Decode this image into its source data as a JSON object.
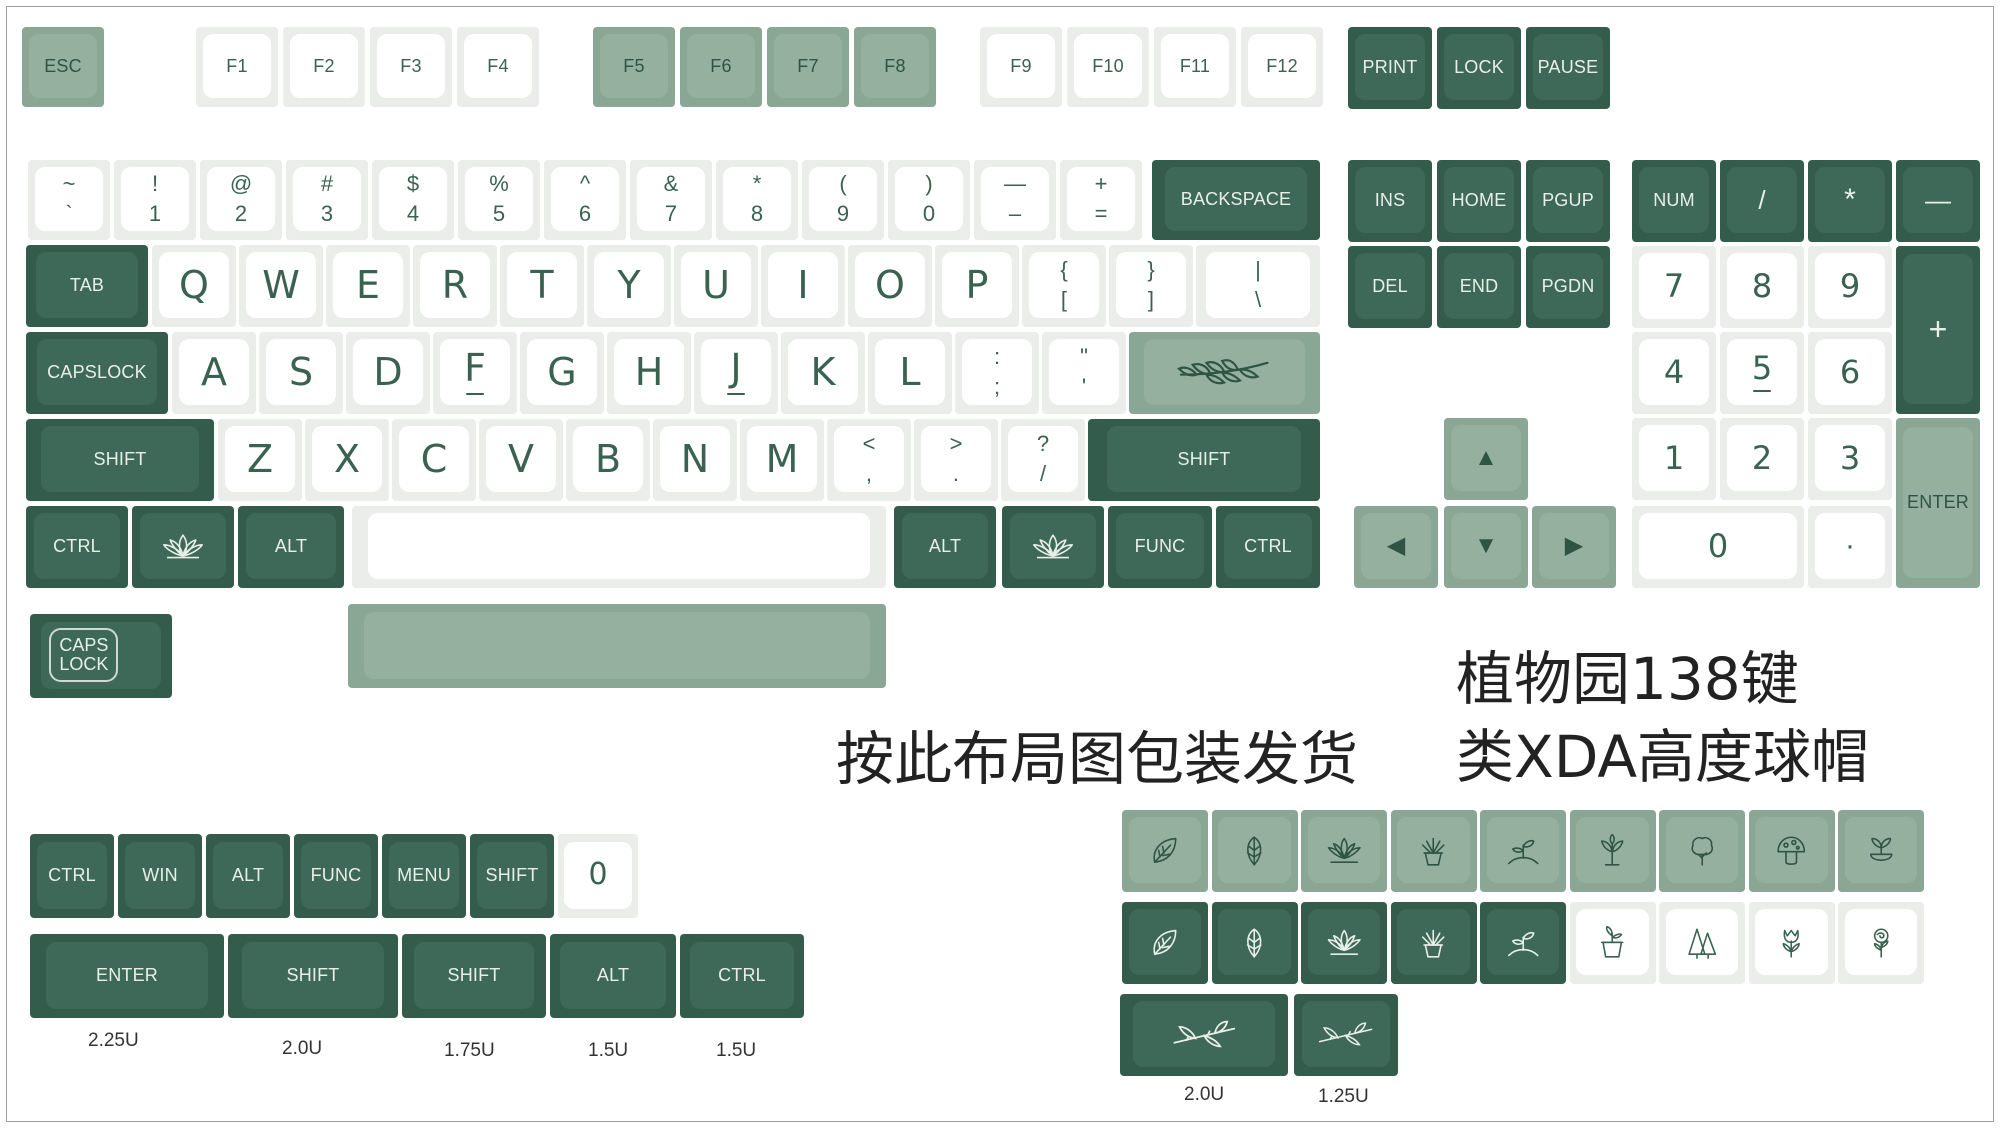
{
  "colors": {
    "light_key": "#ffffff",
    "light_key_edge": "#ebedeb",
    "dark_key": "#345c4d",
    "sage_key": "#8aa694",
    "legend_dark": "#3a6250",
    "legend_light": "#e8efe9"
  },
  "function_row": {
    "esc": "ESC",
    "f1": "F1",
    "f2": "F2",
    "f3": "F3",
    "f4": "F4",
    "f5": "F5",
    "f6": "F6",
    "f7": "F7",
    "f8": "F8",
    "f9": "F9",
    "f10": "F10",
    "f11": "F11",
    "f12": "F12",
    "print": "PRINT",
    "lock": "LOCK",
    "pause": "PAUSE"
  },
  "number_row": {
    "k1": {
      "top": "~",
      "bottom": "`"
    },
    "k2": {
      "top": "!",
      "bottom": "1"
    },
    "k3": {
      "top": "@",
      "bottom": "2"
    },
    "k4": {
      "top": "#",
      "bottom": "3"
    },
    "k5": {
      "top": "$",
      "bottom": "4"
    },
    "k6": {
      "top": "%",
      "bottom": "5"
    },
    "k7": {
      "top": "^",
      "bottom": "6"
    },
    "k8": {
      "top": "&",
      "bottom": "7"
    },
    "k9": {
      "top": "*",
      "bottom": "8"
    },
    "k10": {
      "top": "(",
      "bottom": "9"
    },
    "k11": {
      "top": ")",
      "bottom": "0"
    },
    "k12": {
      "top": "—",
      "bottom": "–"
    },
    "k13": {
      "top": "+",
      "bottom": "="
    },
    "backspace": "BACKSPACE"
  },
  "qwerty_row": {
    "tab": "TAB",
    "letters": [
      "Q",
      "W",
      "E",
      "R",
      "T",
      "Y",
      "U",
      "I",
      "O",
      "P"
    ],
    "lbrace": {
      "top": "{",
      "bottom": "["
    },
    "rbrace": {
      "top": "}",
      "bottom": "]"
    },
    "pipe": {
      "top": "|",
      "bottom": "\\"
    }
  },
  "home_row": {
    "capslock": "CAPSLOCK",
    "letters": [
      "A",
      "S",
      "D",
      "F",
      "G",
      "H",
      "J",
      "K",
      "L"
    ],
    "semicolon": {
      "top": ":",
      "bottom": ";"
    },
    "quote": {
      "top": "\"",
      "bottom": "'"
    },
    "enter_icon": "leaf-branch-icon"
  },
  "shift_row": {
    "lshift": "SHIFT",
    "letters": [
      "Z",
      "X",
      "C",
      "V",
      "B",
      "N",
      "M"
    ],
    "comma": {
      "top": "<",
      "bottom": ","
    },
    "period": {
      "top": ">",
      "bottom": "."
    },
    "slash": {
      "top": "?",
      "bottom": "/"
    },
    "rshift": "SHIFT"
  },
  "bottom_row": {
    "lctrl": "CTRL",
    "lwin_icon": "lotus-icon",
    "lalt": "ALT",
    "ralt": "ALT",
    "rwin_icon": "lotus-icon",
    "func": "FUNC",
    "rctrl": "CTRL"
  },
  "nav_cluster": {
    "ins": "INS",
    "home": "HOME",
    "pgup": "PGUP",
    "del": "DEL",
    "end": "END",
    "pgdn": "PGDN",
    "up": "▲",
    "left": "◀",
    "down": "▼",
    "right": "▶"
  },
  "numpad": {
    "num": "NUM",
    "divide": "/",
    "multiply": "*",
    "minus": "—",
    "n7": "7",
    "n8": "8",
    "n9": "9",
    "plus": "+",
    "n4": "4",
    "n5": "5",
    "n6": "6",
    "n1": "1",
    "n2": "2",
    "n3": "3",
    "enter": "ENTER",
    "n0": "0",
    "dot": "·"
  },
  "extras": {
    "caps_lock_line1": "CAPS",
    "caps_lock_line2": "LOCK"
  },
  "mods_row": {
    "ctrl": "CTRL",
    "win": "WIN",
    "alt": "ALT",
    "func": "FUNC",
    "menu": "MENU",
    "shift": "SHIFT",
    "zero": "0"
  },
  "sized_mods": [
    {
      "label": "ENTER",
      "size": "2.25U"
    },
    {
      "label": "SHIFT",
      "size": "2.0U"
    },
    {
      "label": "SHIFT",
      "size": "1.75U"
    },
    {
      "label": "ALT",
      "size": "1.5U"
    },
    {
      "label": "CTRL",
      "size": "1.5U"
    }
  ],
  "title_lines": {
    "line1": "植物园138键",
    "line2": "类XDA高度球帽",
    "left": "按此布局图包装发货"
  },
  "icon_row1": [
    "leaf-icon",
    "pinecone-icon",
    "lotus-icon",
    "potted-grass-icon",
    "sprout-hill-icon",
    "sapling-icon",
    "tree-icon",
    "mushroom-icon",
    "sprout-pot-icon"
  ],
  "icon_row2": [
    "leaf-icon",
    "pinecone-icon",
    "lotus-icon",
    "potted-grass-icon",
    "sprout-hill-icon",
    "flowerpot-icon",
    "pine-trees-icon",
    "tulip-icon",
    "rose-icon"
  ],
  "bamboo_keys": [
    {
      "icon": "bamboo-icon",
      "size": "2.0U"
    },
    {
      "icon": "bamboo-icon",
      "size": "1.25U"
    }
  ]
}
